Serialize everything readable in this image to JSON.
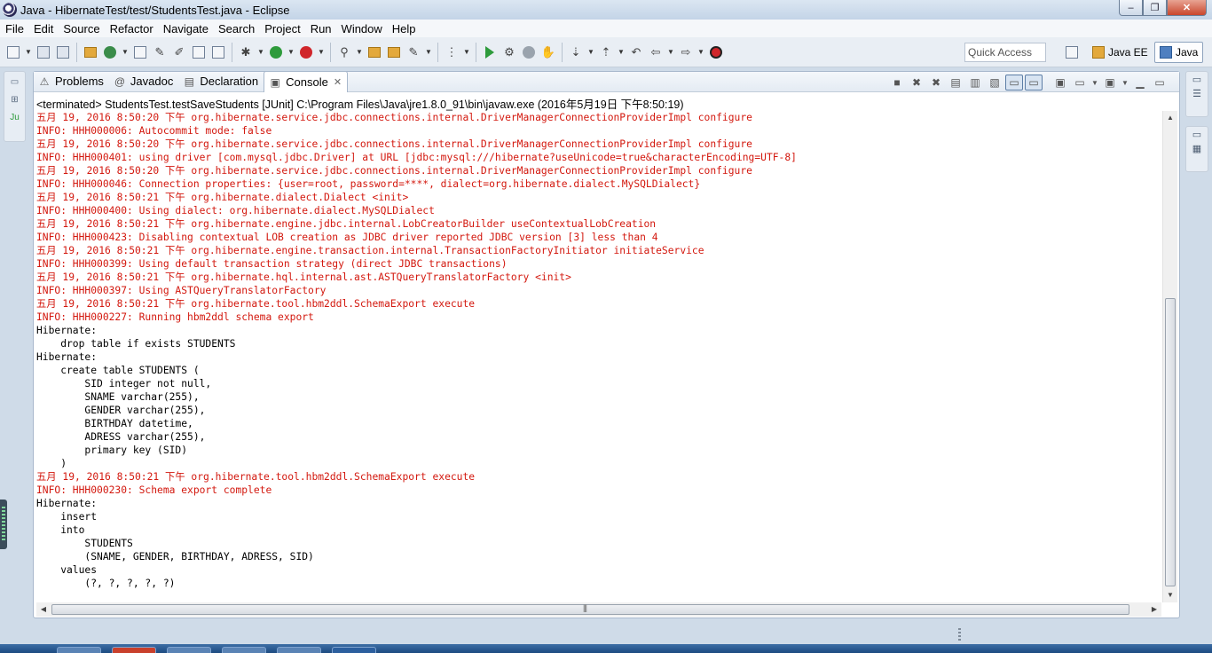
{
  "window": {
    "title": "Java - HibernateTest/test/StudentsTest.java - Eclipse",
    "controls": [
      "–",
      "❐",
      "✕"
    ]
  },
  "menu": [
    {
      "label": "File",
      "mnemonic": "F",
      "rest": "ile"
    },
    {
      "label": "Edit",
      "mnemonic": "E",
      "rest": "dit"
    },
    {
      "label": "Source",
      "mnemonic": "S",
      "rest": "ource"
    },
    {
      "label": "Refactor",
      "mnemonic": "",
      "rest": "Refactor"
    },
    {
      "label": "Navigate",
      "mnemonic": "N",
      "rest": "avigate"
    },
    {
      "label": "Search",
      "mnemonic": "",
      "rest": "Search"
    },
    {
      "label": "Project",
      "mnemonic": "P",
      "rest": "roject"
    },
    {
      "label": "Run",
      "mnemonic": "R",
      "rest": "un"
    },
    {
      "label": "Window",
      "mnemonic": "W",
      "rest": "indow"
    },
    {
      "label": "Help",
      "mnemonic": "H",
      "rest": "elp"
    }
  ],
  "toolbar": {
    "quick_access_placeholder": "Quick Access",
    "perspectives": [
      {
        "label": "Java EE",
        "active": false
      },
      {
        "label": "Java",
        "active": true
      }
    ]
  },
  "tabs": [
    {
      "label": "Problems",
      "icon": "problems-icon",
      "glyph": "⚠",
      "active": false
    },
    {
      "label": "Javadoc",
      "icon": "javadoc-icon",
      "glyph": "@",
      "active": false
    },
    {
      "label": "Declaration",
      "icon": "declaration-icon",
      "glyph": "▤",
      "active": false
    },
    {
      "label": "Console",
      "icon": "console-icon",
      "glyph": "▣",
      "active": true,
      "close": "✕"
    }
  ],
  "console": {
    "status": "<terminated> StudentsTest.testSaveStudents [JUnit] C:\\Program Files\\Java\\jre1.8.0_91\\bin\\javaw.exe (2016年5月19日 下午8:50:19)",
    "lines": [
      {
        "text": "五月 19, 2016 8:50:20 下午 org.hibernate.service.jdbc.connections.internal.DriverManagerConnectionProviderImpl configure",
        "type": "err"
      },
      {
        "text": "INFO: HHH000006: Autocommit mode: false",
        "type": "err"
      },
      {
        "text": "五月 19, 2016 8:50:20 下午 org.hibernate.service.jdbc.connections.internal.DriverManagerConnectionProviderImpl configure",
        "type": "err"
      },
      {
        "text": "INFO: HHH000401: using driver [com.mysql.jdbc.Driver] at URL [jdbc:mysql:///hibernate?useUnicode=true&characterEncoding=UTF-8]",
        "type": "err"
      },
      {
        "text": "五月 19, 2016 8:50:20 下午 org.hibernate.service.jdbc.connections.internal.DriverManagerConnectionProviderImpl configure",
        "type": "err"
      },
      {
        "text": "INFO: HHH000046: Connection properties: {user=root, password=****, dialect=org.hibernate.dialect.MySQLDialect}",
        "type": "err"
      },
      {
        "text": "五月 19, 2016 8:50:21 下午 org.hibernate.dialect.Dialect <init>",
        "type": "err"
      },
      {
        "text": "INFO: HHH000400: Using dialect: org.hibernate.dialect.MySQLDialect",
        "type": "err"
      },
      {
        "text": "五月 19, 2016 8:50:21 下午 org.hibernate.engine.jdbc.internal.LobCreatorBuilder useContextualLobCreation",
        "type": "err"
      },
      {
        "text": "INFO: HHH000423: Disabling contextual LOB creation as JDBC driver reported JDBC version [3] less than 4",
        "type": "err"
      },
      {
        "text": "五月 19, 2016 8:50:21 下午 org.hibernate.engine.transaction.internal.TransactionFactoryInitiator initiateService",
        "type": "err"
      },
      {
        "text": "INFO: HHH000399: Using default transaction strategy (direct JDBC transactions)",
        "type": "err"
      },
      {
        "text": "五月 19, 2016 8:50:21 下午 org.hibernate.hql.internal.ast.ASTQueryTranslatorFactory <init>",
        "type": "err"
      },
      {
        "text": "INFO: HHH000397: Using ASTQueryTranslatorFactory",
        "type": "err"
      },
      {
        "text": "五月 19, 2016 8:50:21 下午 org.hibernate.tool.hbm2ddl.SchemaExport execute",
        "type": "err"
      },
      {
        "text": "INFO: HHH000227: Running hbm2ddl schema export",
        "type": "err"
      },
      {
        "text": "Hibernate: ",
        "type": "out"
      },
      {
        "text": "    drop table if exists STUDENTS",
        "type": "out"
      },
      {
        "text": "Hibernate: ",
        "type": "out"
      },
      {
        "text": "    create table STUDENTS (",
        "type": "out"
      },
      {
        "text": "        SID integer not null,",
        "type": "out"
      },
      {
        "text": "        SNAME varchar(255),",
        "type": "out"
      },
      {
        "text": "        GENDER varchar(255),",
        "type": "out"
      },
      {
        "text": "        BIRTHDAY datetime,",
        "type": "out"
      },
      {
        "text": "        ADRESS varchar(255),",
        "type": "out"
      },
      {
        "text": "        primary key (SID)",
        "type": "out"
      },
      {
        "text": "    )",
        "type": "out"
      },
      {
        "text": "五月 19, 2016 8:50:21 下午 org.hibernate.tool.hbm2ddl.SchemaExport execute",
        "type": "err"
      },
      {
        "text": "INFO: HHH000230: Schema export complete",
        "type": "err"
      },
      {
        "text": "Hibernate: ",
        "type": "out"
      },
      {
        "text": "    insert ",
        "type": "out"
      },
      {
        "text": "    into",
        "type": "out"
      },
      {
        "text": "        STUDENTS",
        "type": "out"
      },
      {
        "text": "        (SNAME, GENDER, BIRTHDAY, ADRESS, SID) ",
        "type": "out"
      },
      {
        "text": "    values",
        "type": "out"
      },
      {
        "text": "        (?, ?, ?, ?, ?)",
        "type": "out"
      }
    ]
  },
  "colors": {
    "stderr": "#d3180e",
    "stdout": "#000000",
    "window_bg": "#cfdbe8"
  }
}
